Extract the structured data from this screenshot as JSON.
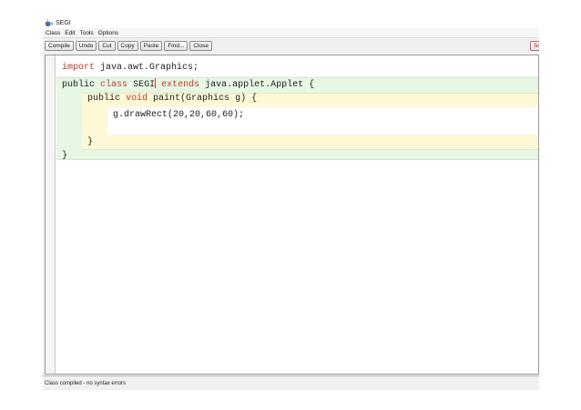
{
  "window": {
    "title": "SEGI",
    "icon": "applet-cup-icon"
  },
  "menu": {
    "items": [
      "Class",
      "Edit",
      "Tools",
      "Options"
    ]
  },
  "toolbar": {
    "buttons": [
      "Compile",
      "Undo",
      "Cut",
      "Copy",
      "Paste",
      "Find...",
      "Close"
    ],
    "right_button": "So"
  },
  "editor": {
    "line1": {
      "kw": "import",
      "rest": " java.awt.Graphics;"
    },
    "line2": {
      "kw1": "public",
      "kw2": "class",
      "name": "SEGI",
      "kw3": "extends",
      "rest": " java.applet.Applet {"
    },
    "line3": {
      "kw1": "public",
      "kw2": "void",
      "rest": " paint(Graphics g) {"
    },
    "line4": {
      "text": "g.drawRect(20,20,60,60);"
    },
    "line5": {
      "text": "}"
    },
    "line6": {
      "text": "}"
    }
  },
  "status": {
    "text": "Class compiled - no syntax errors"
  },
  "colors": {
    "keyword": "#c0392b",
    "class_scope": "#e6f7e4",
    "method_scope": "#fdf8d6"
  }
}
